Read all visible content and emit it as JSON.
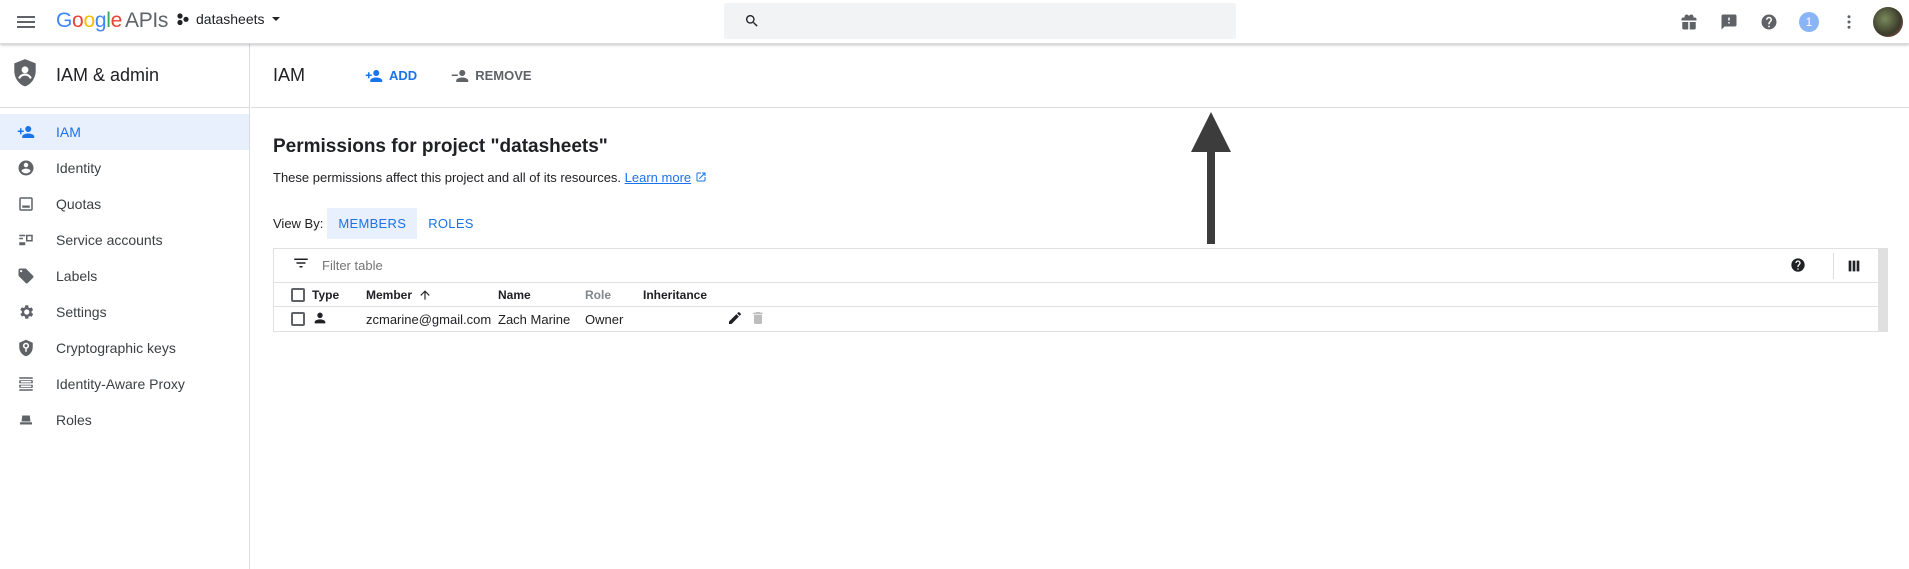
{
  "topbar": {
    "logo_google": "Google",
    "logo_apis": "APIs",
    "project_name": "datasheets",
    "search_placeholder": "",
    "notification_count": "1"
  },
  "sidebar": {
    "title": "IAM & admin",
    "items": [
      {
        "label": "IAM",
        "icon": "person-add-icon",
        "active": true
      },
      {
        "label": "Identity",
        "icon": "account-circle-icon"
      },
      {
        "label": "Quotas",
        "icon": "quotas-icon"
      },
      {
        "label": "Service accounts",
        "icon": "service-account-icon"
      },
      {
        "label": "Labels",
        "icon": "label-icon"
      },
      {
        "label": "Settings",
        "icon": "gear-icon"
      },
      {
        "label": "Cryptographic keys",
        "icon": "crypto-key-icon"
      },
      {
        "label": "Identity-Aware Proxy",
        "icon": "iap-icon"
      },
      {
        "label": "Roles",
        "icon": "roles-icon"
      }
    ]
  },
  "main": {
    "page_title": "IAM",
    "add_label": "ADD",
    "remove_label": "REMOVE",
    "section_title": "Permissions for project \"datasheets\"",
    "description": "These permissions affect this project and all of its resources.",
    "learn_more": "Learn more",
    "view_by_label": "View By:",
    "view_tabs": [
      "MEMBERS",
      "ROLES"
    ],
    "filter_placeholder": "Filter table",
    "columns": [
      "Type",
      "Member",
      "Name",
      "Role",
      "Inheritance"
    ],
    "rows": [
      {
        "type": "person-icon",
        "member": "zcmarine@gmail.com",
        "name": "Zach Marine",
        "role": "Owner",
        "inheritance": ""
      }
    ]
  },
  "colors": {
    "accent": "#1a73e8",
    "active_bg": "#e8f0fe",
    "annotation_arrow": "#3c3c3c"
  }
}
